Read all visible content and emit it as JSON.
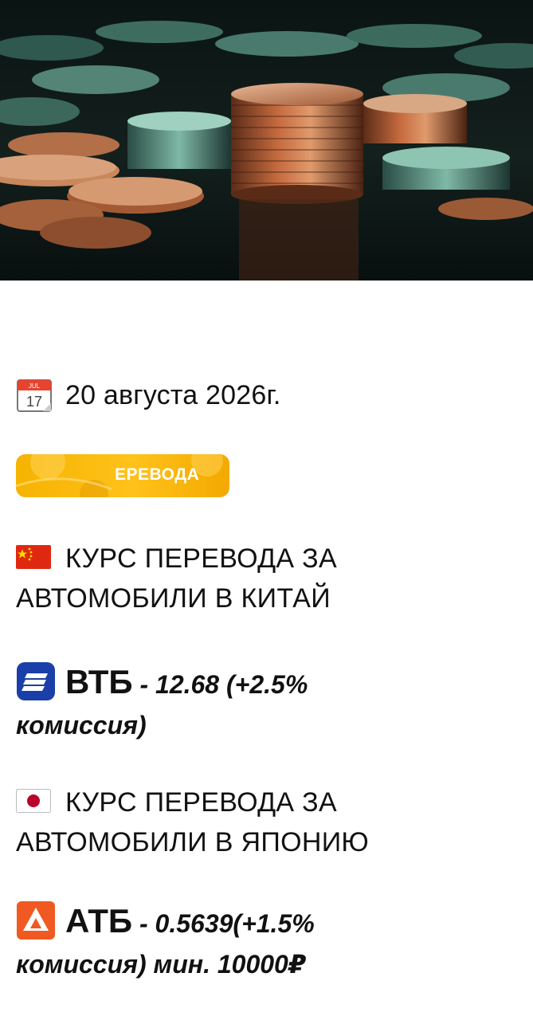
{
  "post": {
    "date": "20 августа 2026г.",
    "calendar_icon": {
      "month": "JUL",
      "day": "17"
    },
    "banner_text": "ЕРЕВОДА",
    "china": {
      "heading_line1": "КУРС ПЕРЕВОДА ЗА",
      "heading_line2": "АВТОМОБИЛИ В КИТАЙ",
      "bank": "ВТБ",
      "rate_line1": " - 12.68 (+2.5%",
      "rate_line2": "комиссия)"
    },
    "japan": {
      "heading_line1": "КУРС ПЕРЕВОДА ЗА",
      "heading_line2": "АВТОМОБИЛИ В ЯПОНИЮ",
      "bank": "АТБ",
      "rate_line1": " -  0.5639(+1.5%",
      "rate_line2": "комиссия) мин. 10000₽"
    }
  },
  "icons": [
    "coins-photo",
    "calendar-icon",
    "china-flag-icon",
    "japan-flag-icon",
    "vtb-logo-icon",
    "atb-logo-icon"
  ],
  "colors": {
    "banner": "#ffc21a",
    "vtb_blue": "#1b3fa8",
    "atb_orange": "#f05a22",
    "china_red": "#de2910",
    "japan_red": "#bc002d"
  }
}
